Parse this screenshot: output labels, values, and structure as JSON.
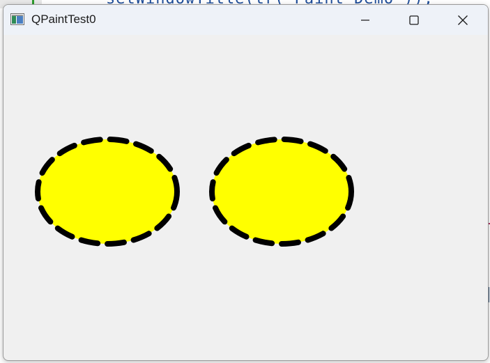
{
  "window": {
    "title": "QPaintTest0"
  },
  "background": {
    "code_text": "setWindowTitle(tr(\"Paint Demo\"));"
  },
  "canvas": {
    "shapes": [
      {
        "type": "ellipse",
        "fill": "#ffff00",
        "stroke": "#000000",
        "stroke_style": "dashed"
      },
      {
        "type": "ellipse",
        "fill": "#ffff00",
        "stroke": "#000000",
        "stroke_style": "dashed"
      }
    ]
  },
  "controls": {
    "minimize_icon": "minimize-icon",
    "maximize_icon": "maximize-icon",
    "close_icon": "close-icon"
  }
}
